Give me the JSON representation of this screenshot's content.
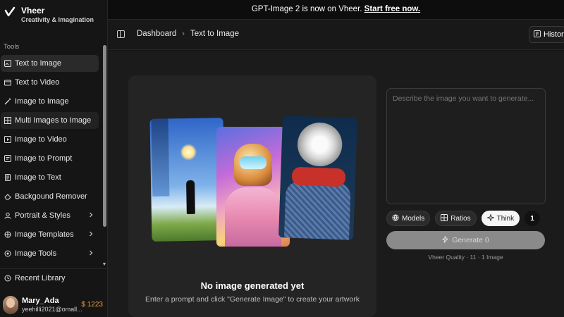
{
  "brand": {
    "name": "Vheer",
    "tagline": "Creativity & Imagination"
  },
  "sidebar": {
    "section_label": "Tools",
    "items": [
      {
        "label": "Text to Image",
        "icon": "image-edit-icon",
        "state": "active"
      },
      {
        "label": "Text to Video",
        "icon": "video-icon"
      },
      {
        "label": "Image to Image",
        "icon": "magic-wand-icon"
      },
      {
        "label": "Multi Images to Image",
        "icon": "grid-icon",
        "state": "highlighted"
      },
      {
        "label": "Image to Video",
        "icon": "film-icon"
      },
      {
        "label": "Image to Prompt",
        "icon": "prompt-icon"
      },
      {
        "label": "Image to Text",
        "icon": "document-icon"
      },
      {
        "label": "Backgound Remover",
        "icon": "eraser-icon"
      },
      {
        "label": "Portrait & Styles",
        "icon": "portrait-icon",
        "has_submenu": true
      },
      {
        "label": "Image Templates",
        "icon": "template-icon",
        "has_submenu": true
      },
      {
        "label": "Image Tools",
        "icon": "tools-icon",
        "has_submenu": true
      }
    ],
    "recent_label": "Recent Library",
    "user": {
      "name": "Mary_Ada",
      "email": "yeehilli2021@omall...",
      "credits": "$ 1223"
    }
  },
  "banner": {
    "text": "GPT-Image 2 is now on Vheer. ",
    "link": "Start free now."
  },
  "header": {
    "breadcrumb": [
      "Dashboard",
      "Text to Image"
    ],
    "history_label": "History"
  },
  "preview": {
    "title": "No image generated yet",
    "subtitle": "Enter a prompt and click \"Generate Image\" to create your artwork"
  },
  "prompt": {
    "placeholder": "Describe the image you want to generate..."
  },
  "options": {
    "models": "Models",
    "ratios": "Ratios",
    "think": "Think",
    "count": "1"
  },
  "generate": {
    "label": "Generate 0"
  },
  "quality": "Vheer Quality · 11 · 1 Image",
  "colors": {
    "accent_credits": "#f0a040",
    "active_item": "#2a2a2a",
    "background": "#1b1b1b"
  }
}
